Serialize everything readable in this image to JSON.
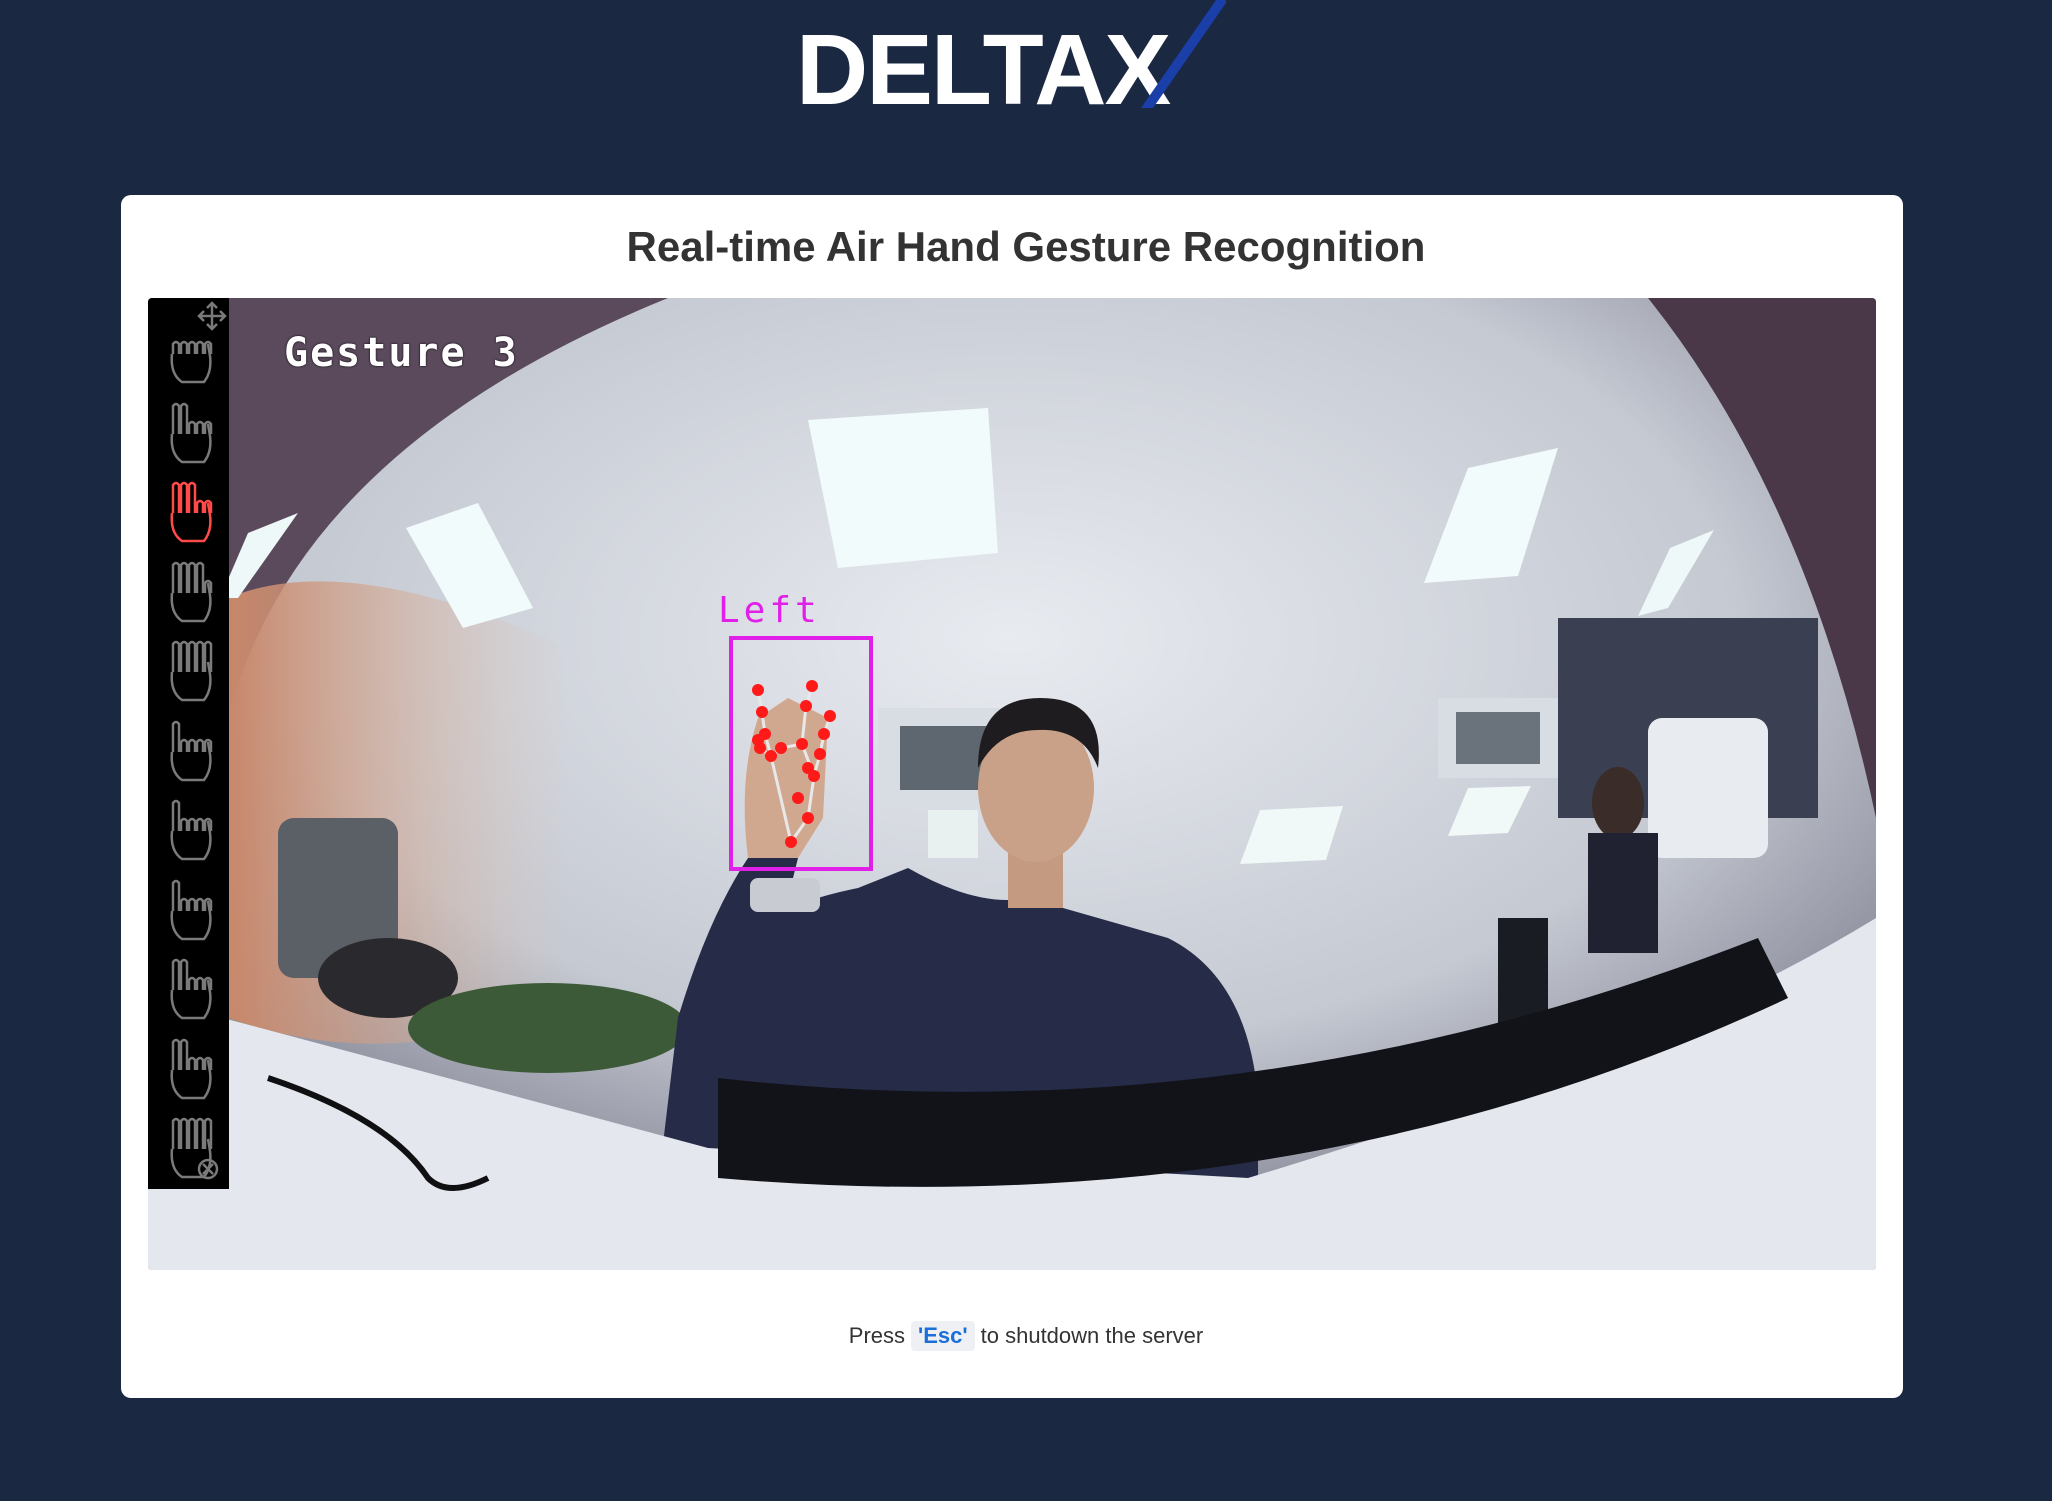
{
  "header": {
    "logo_text": "DELTAX"
  },
  "card": {
    "title": "Real-time Air Hand Gesture Recognition"
  },
  "video": {
    "gesture_label": "Gesture 3",
    "hand_label": "Left",
    "gesture_icons": [
      {
        "name": "fist-hand-icon",
        "active": false
      },
      {
        "name": "two-fingers-icon",
        "active": false
      },
      {
        "name": "three-fingers-icon",
        "active": true
      },
      {
        "name": "four-fingers-icon",
        "active": false
      },
      {
        "name": "open-palm-icon",
        "active": false
      },
      {
        "name": "rotate-finger-icon",
        "active": false
      },
      {
        "name": "point-up-icon",
        "active": false
      },
      {
        "name": "thumbs-up-icon",
        "active": false
      },
      {
        "name": "pinch-out-icon",
        "active": false
      },
      {
        "name": "pinch-in-icon",
        "active": false
      },
      {
        "name": "cancel-hand-icon",
        "active": false
      }
    ],
    "active_color": "#ff4a4a",
    "inactive_color": "#7a7a7a",
    "bbox_color": "#e020e8"
  },
  "footer": {
    "prefix": "Press",
    "key": "'Esc'",
    "suffix": "to shutdown the server"
  },
  "colors": {
    "background": "#1a2842",
    "card": "#ffffff",
    "accent": "#1a3fa8"
  }
}
